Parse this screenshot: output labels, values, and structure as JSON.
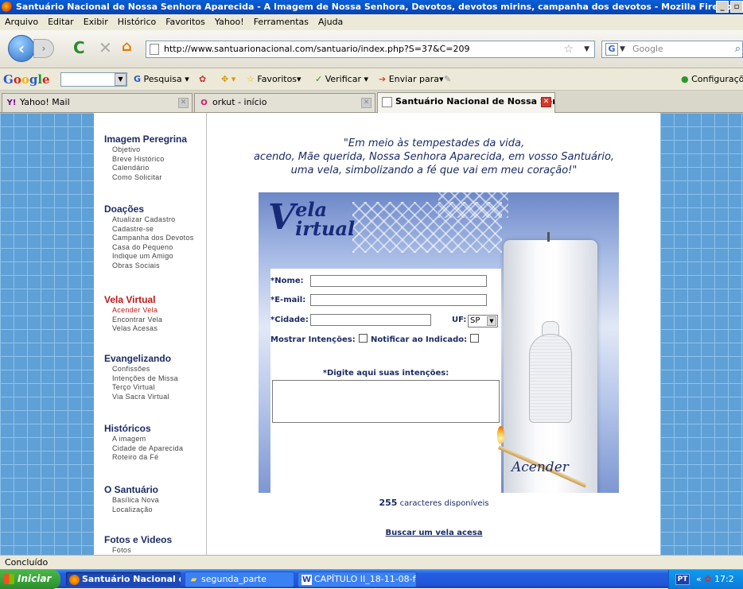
{
  "window": {
    "title": "Santuário Nacional de Nossa Senhora Aparecida - A Imagem de Nossa Senhora, Devotos, devotos mirins, campanha dos devotos - Mozilla Firefox"
  },
  "menu": [
    "Arquivo",
    "Editar",
    "Exibir",
    "Histórico",
    "Favoritos",
    "Yahoo!",
    "Ferramentas",
    "Ajuda"
  ],
  "nav": {
    "url": "http://www.santuarionacional.com/santuario/index.php?S=37&C=209",
    "search_placeholder": "Google"
  },
  "googlebar": {
    "logo": [
      "G",
      "o",
      "o",
      "g",
      "l",
      "e"
    ],
    "pesquisa": "Pesquisa",
    "favoritos": "Favoritos",
    "verificar": "Verificar",
    "enviar": "Enviar para",
    "configuracoes": "Configurações"
  },
  "tabs": [
    {
      "label": "Yahoo! Mail",
      "icon": "Y!"
    },
    {
      "label": "orkut - início",
      "icon": "O"
    },
    {
      "label": "Santuário Nacional de Nossa Sen...",
      "icon": ""
    }
  ],
  "sidebar": {
    "sections": [
      {
        "title": "Imagem Peregrina",
        "items": [
          "Objetivo",
          "Breve Histórico",
          "Calendário",
          "Como Solicitar"
        ]
      },
      {
        "title": "Doações",
        "items": [
          "Atualizar Cadastro",
          "Cadastre-se",
          "Campanha dos Devotos",
          "Casa do Pequeno",
          "Indique um Amigo",
          "Obras Sociais"
        ]
      },
      {
        "title": "Vela Virtual",
        "items": [
          "Acender Vela",
          "Encontrar Vela",
          "Velas Acesas"
        ]
      },
      {
        "title": "Evangelizando",
        "items": [
          "Confissões",
          "Intenções de Missa",
          "Terço Virtual",
          "Via Sacra Virtual"
        ]
      },
      {
        "title": "Históricos",
        "items": [
          "A imagem",
          "Cidade de Aparecida",
          "Roteiro da Fé"
        ]
      },
      {
        "title": "O Santuário",
        "items": [
          "Basílica Nova",
          "Localização"
        ]
      },
      {
        "title": "Fotos e Videos",
        "items": [
          "Fotos"
        ]
      }
    ]
  },
  "main": {
    "quote_1": "\"Em meio às tempestades da vida,",
    "quote_2": "acendo, Mãe querida, Nossa Senhora Aparecida, em vosso Santuário,",
    "quote_3": "uma vela, simbolizando a fé que vai em meu coração!\"",
    "logo_v": "V",
    "logo_ela": "ela",
    "logo_irtual": "irtual",
    "form": {
      "nome_label": "*Nome:",
      "email_label": "*E-mail:",
      "cidade_label": "*Cidade:",
      "uf_label": "UF:",
      "uf_value": "SP",
      "mostrar_label": "Mostrar Intenções:",
      "notificar_label": "Notificar ao Indicado:",
      "intencoes_label": "*Digite aqui suas intenções:"
    },
    "acender": "Acender",
    "chars_count": "255",
    "chars_text": "caracteres disponíveis",
    "buscar": "Buscar um vela acesa"
  },
  "status": "Concluído",
  "taskbar": {
    "start": "Iniciar",
    "tasks": [
      "Santuário Nacional de...",
      "segunda_parte",
      "CAPÍTULO II_18-11-08-f..."
    ],
    "lang": "PT",
    "clock": "17:2"
  }
}
